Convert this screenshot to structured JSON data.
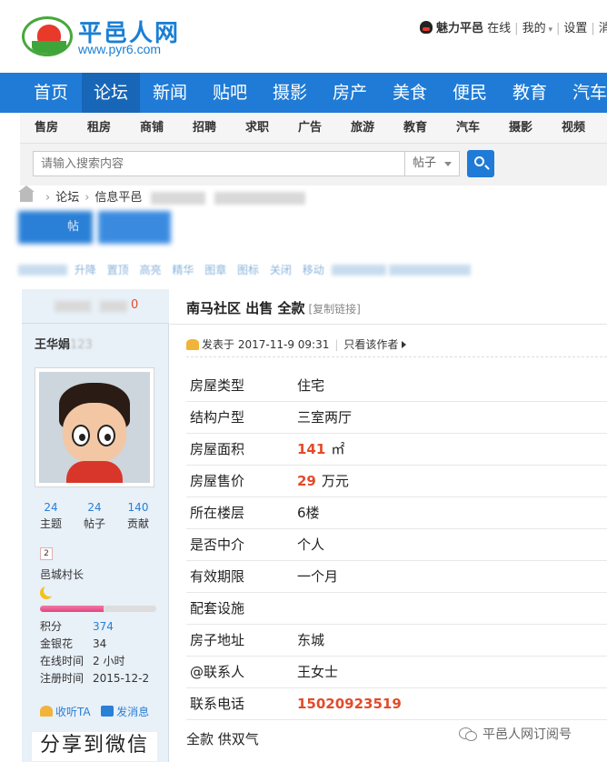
{
  "header": {
    "logo_text": "平邑人网",
    "logo_url": "www.pyr6.com",
    "user_name": "魅力平邑",
    "user_status": "在线",
    "menu_mine": "我的",
    "menu_settings": "设置",
    "menu_more": "消"
  },
  "nav": {
    "active_index": 1,
    "items": [
      "首页",
      "论坛",
      "新闻",
      "贴吧",
      "摄影",
      "房产",
      "美食",
      "便民",
      "教育",
      "汽车"
    ]
  },
  "subnav": {
    "items": [
      "售房",
      "租房",
      "商铺",
      "招聘",
      "求职",
      "广告",
      "旅游",
      "教育",
      "汽车",
      "摄影",
      "视频"
    ]
  },
  "search": {
    "placeholder": "请输入搜索内容",
    "type_label": "帖子"
  },
  "breadcrumb": {
    "items": [
      "论坛",
      "信息平邑"
    ]
  },
  "actions": {
    "post_label": "帖"
  },
  "toolbar": {
    "items": [
      "升降",
      "置顶",
      "高亮",
      "精华",
      "图章",
      "图标",
      "关闭",
      "移动"
    ]
  },
  "sidebar": {
    "reply_count": "0",
    "author_name": "王华娟",
    "author_suffix": "123",
    "stats": [
      {
        "value": "24",
        "label": "主题"
      },
      {
        "value": "24",
        "label": "帖子"
      },
      {
        "value": "140",
        "label": "贡献"
      }
    ],
    "level": "2",
    "rank": "邑城村长",
    "progress_fraction": 0.55,
    "info": [
      {
        "key": "积分",
        "value": "374"
      },
      {
        "key": "金银花",
        "value": "34"
      },
      {
        "key": "在线时间",
        "value": "2 小时"
      },
      {
        "key": "注册时间",
        "value": "2015-12-2"
      }
    ],
    "follow_label": "收听TA",
    "message_label": "发消息",
    "share_label": "分享到微信"
  },
  "post": {
    "title": "南马社区 出售 全款",
    "copy_link": "[复制链接]",
    "posted_prefix": "发表于",
    "posted_time": "2017-11-9 09:31",
    "only_author": "只看该作者",
    "fields": [
      {
        "key": "房屋类型",
        "value": "住宅",
        "unit": "",
        "highlight": false
      },
      {
        "key": "结构户型",
        "value": "三室两厅",
        "unit": "",
        "highlight": false
      },
      {
        "key": "房屋面积",
        "value": "141",
        "unit": "㎡",
        "highlight": true
      },
      {
        "key": "房屋售价",
        "value": "29",
        "unit": "万元",
        "highlight": true
      },
      {
        "key": "所在楼层",
        "value": "6楼",
        "unit": "",
        "highlight": false
      },
      {
        "key": "是否中介",
        "value": "个人",
        "unit": "",
        "highlight": false
      },
      {
        "key": "有效期限",
        "value": "一个月",
        "unit": "",
        "highlight": false
      },
      {
        "key": "配套设施",
        "value": "",
        "unit": "",
        "highlight": false
      },
      {
        "key": "房子地址",
        "value": "东城",
        "unit": "",
        "highlight": false
      },
      {
        "key": "@联系人",
        "value": "王女士",
        "unit": "",
        "highlight": false
      },
      {
        "key": "联系电话",
        "value": "15020923519",
        "unit": "",
        "highlight": true
      }
    ],
    "footnote": "全款  供双气"
  },
  "watermark": {
    "text": "平邑人网订阅号"
  }
}
